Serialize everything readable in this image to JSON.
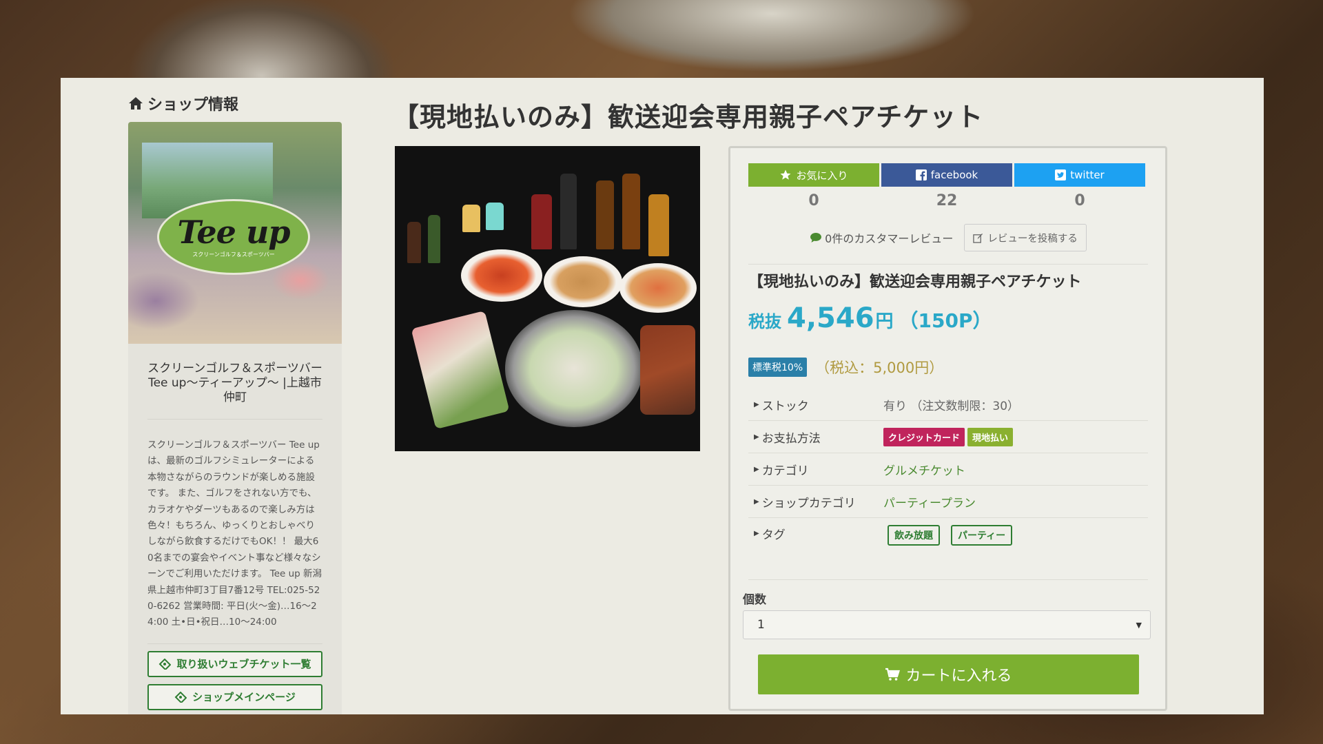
{
  "sidebar": {
    "heading": "ショップ情報",
    "shop_logo_text": "Tee up",
    "shop_logo_sub": "スクリーンゴルフ＆スポーツバー",
    "shop_name": "スクリーンゴルフ＆スポーツバー Tee up〜ティーアップ〜 |上越市仲町",
    "description": "スクリーンゴルフ＆スポーツバー Tee upは、最新のゴルフシミュレーターによる本物さながらのラウンドが楽しめる施設です。 また、ゴルフをされない方でも、カラオケやダーツもあるので楽しみ方は色々！もちろん、ゆっくりとおしゃべりしながら飲食するだけでもOK！！ 最大60名までの宴会やイベント事など様々なシーンでご利用いただけます。 Tee up 新潟県上越市仲町3丁目7番12号 TEL:025-520-6262 営業時間: 平日(火〜金)…16〜24:00 土•日•祝日…10〜24:00",
    "buttons": {
      "ticket_list": "取り扱いウェブチケット一覧",
      "shop_main": "ショップメインページ"
    }
  },
  "product": {
    "title": "【現地払いのみ】歓送迎会専用親子ペアチケット",
    "social": {
      "favorite_label": "お気に入り",
      "facebook_label": "facebook",
      "twitter_label": "twitter",
      "favorite_count": "0",
      "facebook_count": "22",
      "twitter_count": "0"
    },
    "reviews": {
      "count_text": "0件のカスタマーレビュー",
      "post_button": "レビューを投稿する"
    },
    "subtitle": "【現地払いのみ】歓送迎会専用親子ペアチケット",
    "price": {
      "label": "税抜",
      "value": "4,546",
      "unit": "円",
      "points": "（150P）",
      "tax_badge": "標準税10%",
      "tax_included": "（税込：5,000円）"
    },
    "specs": {
      "stock_key": "ストック",
      "stock_val": "有り （注文数制限：30）",
      "payment_key": "お支払方法",
      "payment_card": "クレジットカード",
      "payment_local": "現地払い",
      "category_key": "カテゴリ",
      "category_val": "グルメチケット",
      "shop_category_key": "ショップカテゴリ",
      "shop_category_val": "パーティープラン",
      "tag_key": "タグ",
      "tags": [
        "飲み放題",
        "パーティー"
      ]
    },
    "quantity": {
      "label": "個数",
      "value": "1"
    },
    "cart_button": "カートに入れる"
  },
  "colors": {
    "accent_green": "#7cb030",
    "price_blue": "#2aa8c8",
    "facebook": "#3b5998",
    "twitter": "#1da1f2",
    "tag_green": "#2e7d32"
  },
  "icons": [
    "home-icon",
    "star-icon",
    "facebook-icon",
    "twitter-icon",
    "comment-icon",
    "edit-icon",
    "ticket-icon",
    "cart-icon",
    "chevron-down-icon"
  ]
}
